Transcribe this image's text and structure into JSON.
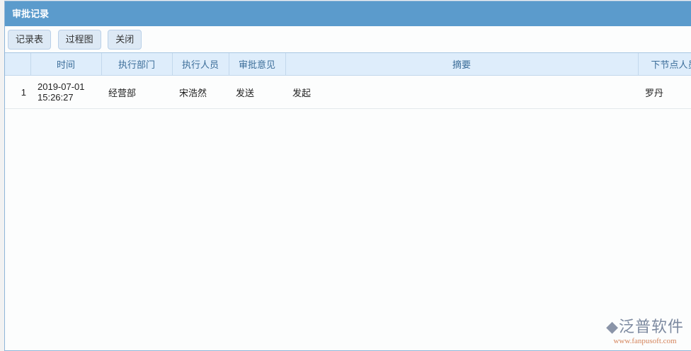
{
  "window": {
    "title": "审批记录"
  },
  "toolbar": {
    "record_table": "记录表",
    "process_chart": "过程图",
    "close": "关闭"
  },
  "table": {
    "headers": [
      "",
      "时间",
      "执行部门",
      "执行人员",
      "审批意见",
      "摘要",
      "下节点人员"
    ],
    "rows": [
      {
        "num": "1",
        "time_date": "2019-07-01",
        "time_clock": "15:26:27",
        "dept": "经营部",
        "person": "宋浩然",
        "opinion": "发送",
        "summary": "发起",
        "next": "罗丹"
      }
    ]
  },
  "logo": {
    "name": "泛普软件",
    "url": "www.fanpusoft.com"
  }
}
